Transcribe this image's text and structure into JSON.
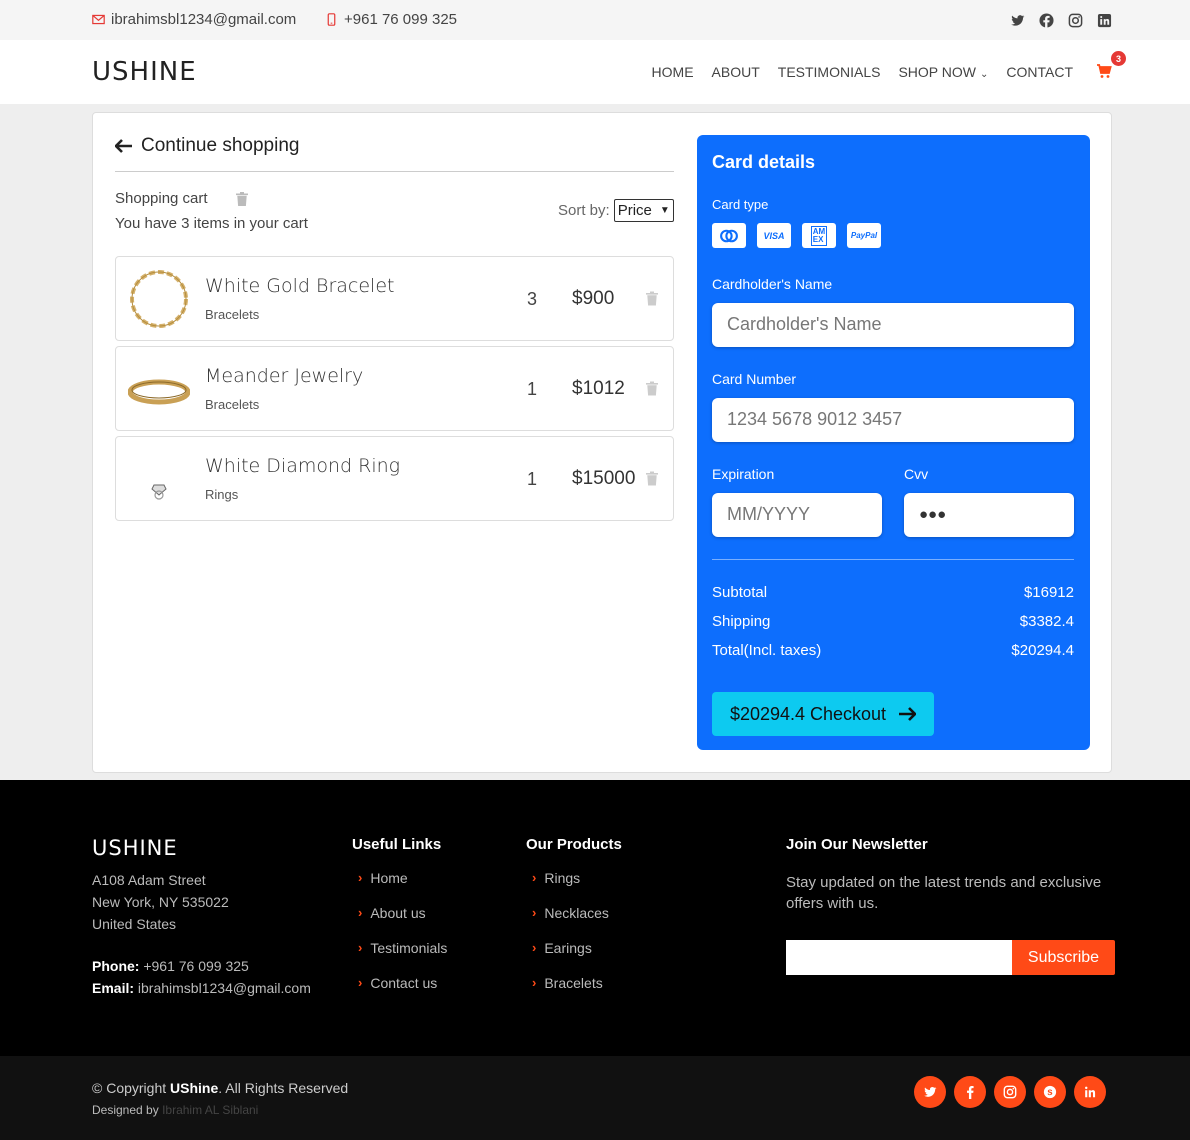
{
  "topbar": {
    "email": "ibrahimsbl1234@gmail.com",
    "phone": "+961 76 099 325",
    "socials": [
      "twitter-icon",
      "facebook-icon",
      "instagram-icon",
      "linkedin-icon"
    ]
  },
  "header": {
    "logo": "USHINE",
    "nav": [
      {
        "label": "HOME"
      },
      {
        "label": "ABOUT"
      },
      {
        "label": "TESTIMONIALS"
      },
      {
        "label": "SHOP NOW"
      },
      {
        "label": "CONTACT"
      }
    ],
    "cart_count": "3"
  },
  "cart": {
    "continue_label": "Continue shopping",
    "title": "Shopping cart",
    "subtitle": "You have 3 items in your cart",
    "sort_label": "Sort by:",
    "sort_value": "Price",
    "items": [
      {
        "name": "White Gold Bracelet",
        "category": "Bracelets",
        "qty": "3",
        "price": "$900"
      },
      {
        "name": "Meander Jewelry",
        "category": "Bracelets",
        "qty": "1",
        "price": "$1012"
      },
      {
        "name": "White Diamond Ring",
        "category": "Rings",
        "qty": "1",
        "price": "$15000"
      }
    ]
  },
  "payment": {
    "heading": "Card details",
    "card_type_label": "Card type",
    "card_types": [
      "MC",
      "VISA",
      "AMEX",
      "PayPal"
    ],
    "name_label": "Cardholder's Name",
    "name_placeholder": "Cardholder's Name",
    "number_label": "Card Number",
    "number_placeholder": "1234 5678 9012 3457",
    "exp_label": "Expiration",
    "exp_placeholder": "MM/YYYY",
    "cvv_label": "Cvv",
    "cvv_value": "●●●",
    "subtotal_label": "Subtotal",
    "subtotal": "$16912",
    "shipping_label": "Shipping",
    "shipping": "$3382.4",
    "total_label": "Total(Incl. taxes)",
    "total": "$20294.4",
    "checkout_label": "$20294.4 Checkout",
    "accent_color": "#0d6efd"
  },
  "footer": {
    "logo": "USHINE",
    "address": [
      "A108 Adam Street",
      "New York, NY 535022",
      "United States"
    ],
    "phone_label": "Phone:",
    "phone": "+961 76 099 325",
    "email_label": "Email:",
    "email": "ibrahimsbl1234@gmail.com",
    "useful_links_title": "Useful Links",
    "useful_links": [
      "Home",
      "About us",
      "Testimonials",
      "Contact us"
    ],
    "products_title": "Our Products",
    "products": [
      "Rings",
      "Necklaces",
      "Earings",
      "Bracelets"
    ],
    "newsletter_title": "Join Our Newsletter",
    "newsletter_text": "Stay updated on the latest trends and exclusive offers with us.",
    "subscribe_label": "Subscribe",
    "accent_color": "#ff4a17"
  },
  "bottom": {
    "copyright_prefix": "© Copyright",
    "copyright_brand": "UShine",
    "copyright_suffix": ". All Rights Reserved",
    "designed_by": "Designed by",
    "author": "Ibrahim AL Siblani"
  }
}
